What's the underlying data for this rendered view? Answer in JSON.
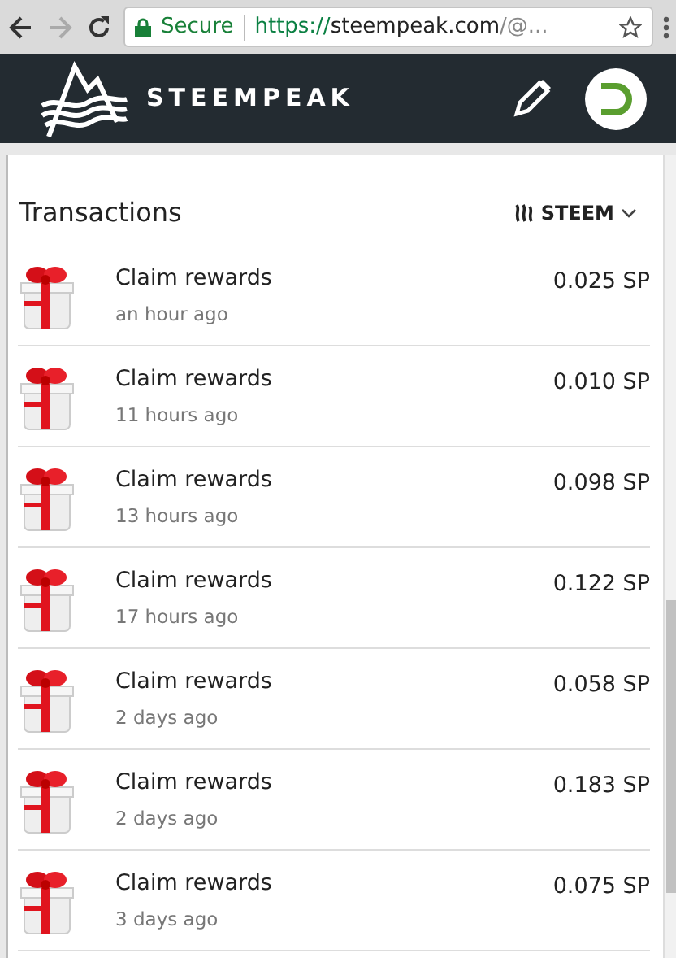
{
  "browser": {
    "secure_label": "Secure",
    "url_scheme": "https://",
    "url_host": "steempeak.com",
    "url_rest": "/@..."
  },
  "header": {
    "brand": "STEEMPEAK"
  },
  "wallet": {
    "title": "Transactions",
    "currency": "STEEM"
  },
  "transactions": [
    {
      "title": "Claim rewards",
      "time": "an hour ago",
      "amount": "0.025 SP"
    },
    {
      "title": "Claim rewards",
      "time": "11 hours ago",
      "amount": "0.010 SP"
    },
    {
      "title": "Claim rewards",
      "time": "13 hours ago",
      "amount": "0.098 SP"
    },
    {
      "title": "Claim rewards",
      "time": "17 hours ago",
      "amount": "0.122 SP"
    },
    {
      "title": "Claim rewards",
      "time": "2 days ago",
      "amount": "0.058 SP"
    },
    {
      "title": "Claim rewards",
      "time": "2 days ago",
      "amount": "0.183 SP"
    },
    {
      "title": "Claim rewards",
      "time": "3 days ago",
      "amount": "0.075 SP"
    }
  ]
}
